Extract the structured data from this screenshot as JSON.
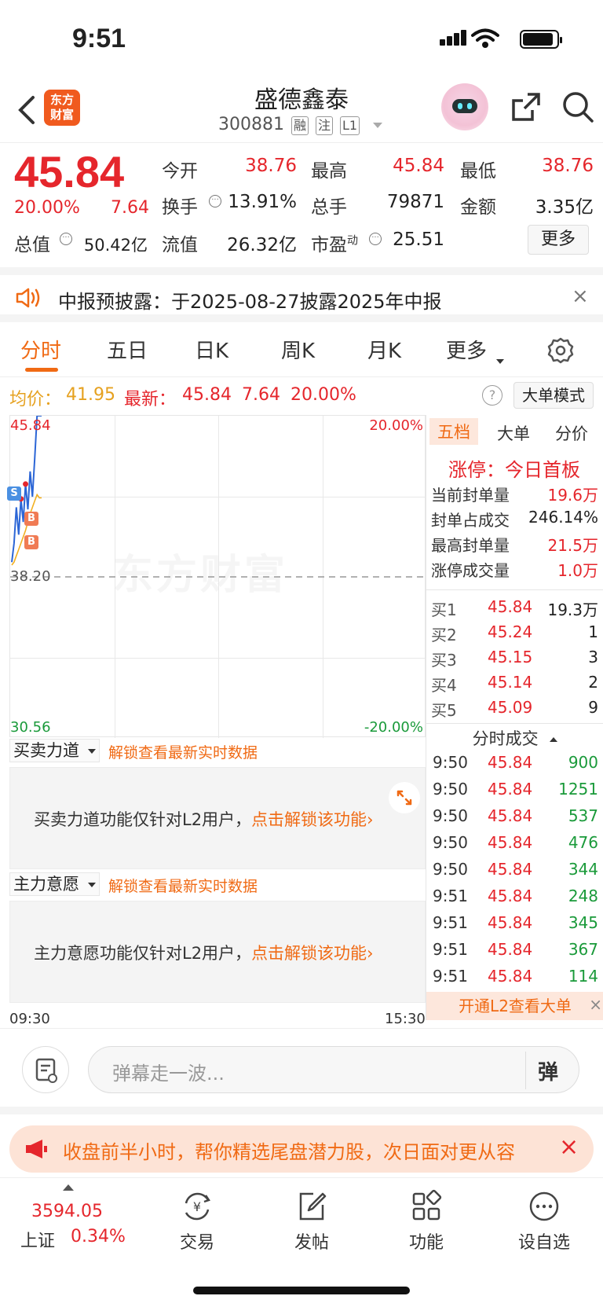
{
  "status_bar": {
    "time": "9:51"
  },
  "header": {
    "back_label": "<",
    "logo_text_1": "东方",
    "logo_text_2": "财富",
    "title": "盛德鑫泰",
    "code": "300881",
    "tags": [
      "融",
      "注",
      "L1"
    ]
  },
  "quote": {
    "price": "45.84",
    "change_pct": "20.00%",
    "change": "7.64",
    "fields": [
      {
        "label": "今开",
        "value": "38.76",
        "color": "red"
      },
      {
        "label": "最高",
        "value": "45.84",
        "color": "red"
      },
      {
        "label": "最低",
        "value": "38.76",
        "color": "red"
      },
      {
        "label": "换手",
        "value": "13.91%",
        "color": "black"
      },
      {
        "label": "总手",
        "value": "79871",
        "color": "black"
      },
      {
        "label": "金额",
        "value": "3.35亿",
        "color": "black"
      },
      {
        "label": "总值",
        "value": "50.42亿",
        "color": "black"
      },
      {
        "label": "流值",
        "value": "26.32亿",
        "color": "black"
      },
      {
        "label": "市盈",
        "label_sup": "动",
        "value": "25.51",
        "color": "black"
      }
    ],
    "more_label": "更多"
  },
  "notice": {
    "text": "中报预披露：于2025-08-27披露2025年中报",
    "close": "×"
  },
  "tabs": [
    {
      "label": "分时",
      "active": true
    },
    {
      "label": "五日",
      "active": false
    },
    {
      "label": "日K",
      "active": false
    },
    {
      "label": "周K",
      "active": false
    },
    {
      "label": "月K",
      "active": false
    },
    {
      "label": "更多",
      "active": false
    }
  ],
  "avg_row": {
    "avg_label": "均价：",
    "avg_value": "41.95",
    "latest_label": "最新：",
    "latest_price": "45.84",
    "latest_change": "7.64",
    "latest_pct": "20.00%",
    "help": "?",
    "mode_label": "大单模式"
  },
  "chart_data": {
    "type": "line",
    "y_top_label": "45.84",
    "y_mid_label": "38.20",
    "y_bottom_label": "30.56",
    "pct_top_label": "20.00%",
    "pct_bottom_label": "-20.00%",
    "x_start_label": "09:30",
    "x_end_label": "15:30",
    "ylim": [
      30.56,
      45.84
    ],
    "prev_close": 38.2,
    "series": [
      {
        "values": [
          38.9,
          39.8,
          41.5,
          40.2,
          41.9,
          40.8,
          42.6,
          41.4,
          43.2,
          42.0,
          43.8,
          45.84,
          45.84,
          45.84
        ]
      },
      {
        "values": [
          38.76,
          38.9,
          39.2,
          39.5,
          39.8,
          40.1,
          40.4,
          40.8,
          41.2,
          41.5,
          41.8,
          42.1,
          41.95,
          41.95
        ]
      }
    ],
    "markers": [
      "S",
      "B",
      "B"
    ],
    "watermark": "东方财富"
  },
  "l2_panels": [
    {
      "select": "买卖力道",
      "link": "解锁查看最新实时数据",
      "msg": "买卖力道功能仅针对L2用户，",
      "action": "点击解锁该功能"
    },
    {
      "select": "主力意愿",
      "link": "解锁查看最新实时数据",
      "msg": "主力意愿功能仅针对L2用户，",
      "action": "点击解锁该功能"
    }
  ],
  "right_panel": {
    "tabs": [
      {
        "label": "五档",
        "active": true
      },
      {
        "label": "大单",
        "active": false
      },
      {
        "label": "分价",
        "active": false
      }
    ],
    "limit_title": "涨停：今日首板",
    "seal_stats": [
      {
        "label": "当前封单量",
        "value": "19.6万",
        "color": "red"
      },
      {
        "label": "封单占成交",
        "value": "246.14%",
        "color": "black"
      },
      {
        "label": "最高封单量",
        "value": "21.5万",
        "color": "red"
      },
      {
        "label": "涨停成交量",
        "value": "1.0万",
        "color": "red"
      }
    ],
    "bids": [
      {
        "label": "买1",
        "price": "45.84",
        "qty": "19.3万"
      },
      {
        "label": "买2",
        "price": "45.24",
        "qty": "1"
      },
      {
        "label": "买3",
        "price": "45.15",
        "qty": "3"
      },
      {
        "label": "买4",
        "price": "45.14",
        "qty": "2"
      },
      {
        "label": "买5",
        "price": "45.09",
        "qty": "9"
      }
    ],
    "ticks_title": "分时成交",
    "ticks": [
      {
        "time": "9:50",
        "price": "45.84",
        "vol": "900"
      },
      {
        "time": "9:50",
        "price": "45.84",
        "vol": "1251"
      },
      {
        "time": "9:50",
        "price": "45.84",
        "vol": "537"
      },
      {
        "time": "9:50",
        "price": "45.84",
        "vol": "476"
      },
      {
        "time": "9:50",
        "price": "45.84",
        "vol": "344"
      },
      {
        "time": "9:51",
        "price": "45.84",
        "vol": "248"
      },
      {
        "time": "9:51",
        "price": "45.84",
        "vol": "345"
      },
      {
        "time": "9:51",
        "price": "45.84",
        "vol": "367"
      },
      {
        "time": "9:51",
        "price": "45.84",
        "vol": "114"
      }
    ],
    "l2_bar": "开通L2查看大单",
    "l2_close": "×"
  },
  "comment": {
    "placeholder": "弹幕走一波...",
    "danmu_label": "弹"
  },
  "promo": {
    "text": "收盘前半小时，帮你精选尾盘潜力股，次日面对更从容",
    "close": "×"
  },
  "nav": {
    "index_value": "3594.05",
    "index_name": "上证",
    "index_pct": "0.34%",
    "items": [
      {
        "label": "交易",
        "icon": "trade-icon"
      },
      {
        "label": "发帖",
        "icon": "post-icon"
      },
      {
        "label": "功能",
        "icon": "grid-icon"
      },
      {
        "label": "设自选",
        "icon": "more-icon"
      }
    ]
  }
}
